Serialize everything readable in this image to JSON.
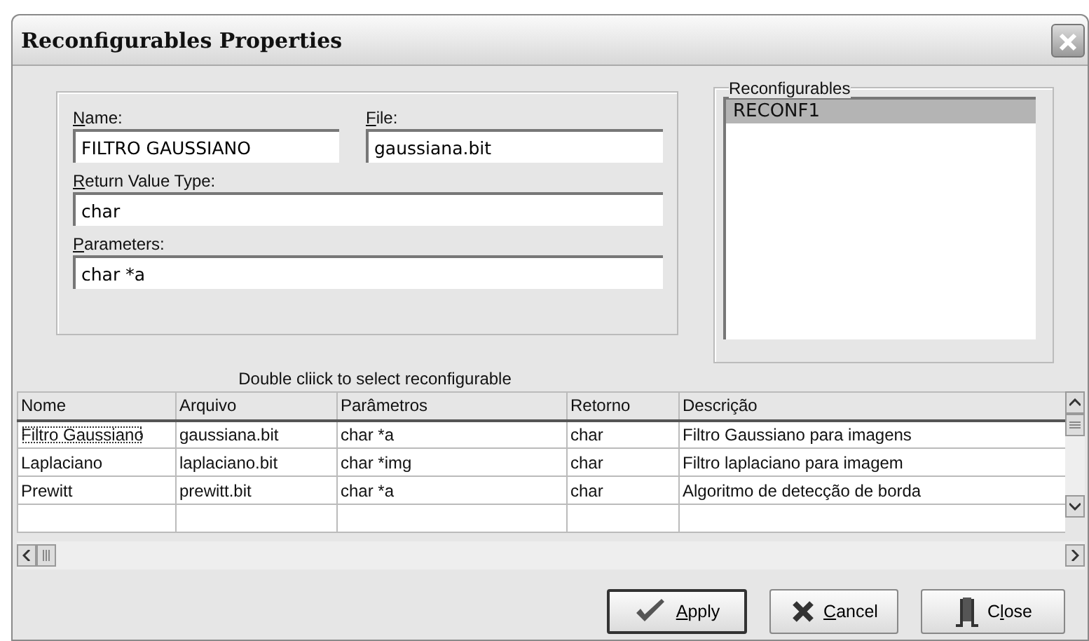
{
  "window": {
    "title": "Reconfigurables Properties"
  },
  "fields": [
    {
      "label_parts": [
        {
          "text": "N",
          "underlined": true
        },
        {
          "text": "ame:",
          "underlined": false
        }
      ],
      "value": "FILTRO GAUSSIANO"
    },
    {
      "label_parts": [
        {
          "text": "F",
          "underlined": true
        },
        {
          "text": "ile:",
          "underlined": false
        }
      ],
      "value": "gaussiana.bit"
    },
    {
      "label_parts": [
        {
          "text": "R",
          "underlined": true
        },
        {
          "text": "eturn Value Type:",
          "underlined": false
        }
      ],
      "value": "char"
    },
    {
      "label_parts": [
        {
          "text": "P",
          "underlined": true
        },
        {
          "text": "arameters:",
          "underlined": false
        }
      ],
      "value": "char *a"
    }
  ],
  "reconfigurables": {
    "title": "Reconfigurables",
    "items": [
      {
        "label": "RECONF1",
        "selected": true
      }
    ]
  },
  "hint": "Double cliick to select reconfigurable",
  "table": {
    "columns": [
      "Nome",
      "Arquivo",
      "Parâmetros",
      "Retorno",
      "Descrição"
    ],
    "rows": [
      {
        "cells": [
          "Filtro Gaussiano",
          "gaussiana.bit",
          "char *a",
          "char",
          "Filtro Gaussiano para imagens"
        ],
        "focused": true
      },
      {
        "cells": [
          "Laplaciano",
          "laplaciano.bit",
          "char *img",
          "char",
          "Filtro laplaciano para imagem"
        ],
        "focused": false
      },
      {
        "cells": [
          "Prewitt",
          "prewitt.bit",
          "char *a",
          "char",
          "Algoritmo de detecção de borda"
        ],
        "focused": false
      }
    ]
  },
  "buttons": [
    {
      "kind": "apply",
      "label_parts": [
        {
          "text": "A",
          "underlined": true
        },
        {
          "text": "pply",
          "underlined": false
        }
      ],
      "default": true
    },
    {
      "kind": "cancel",
      "label_parts": [
        {
          "text": "C",
          "underlined": true
        },
        {
          "text": "ancel",
          "underlined": false
        }
      ],
      "default": false
    },
    {
      "kind": "close",
      "label_parts": [
        {
          "text": "C",
          "underlined": false
        },
        {
          "text": "l",
          "underlined": true
        },
        {
          "text": "ose",
          "underlined": false
        }
      ],
      "default": false
    }
  ]
}
